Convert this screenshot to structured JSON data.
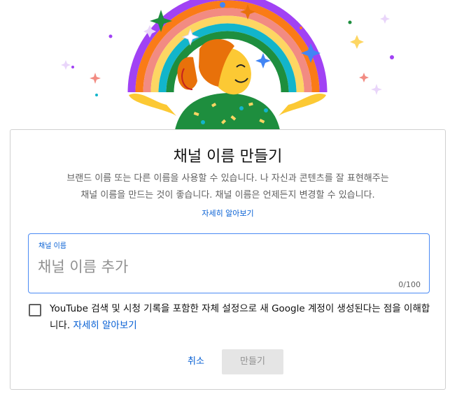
{
  "dialog": {
    "title": "채널 이름 만들기",
    "description_line1": "브랜드 이름 또는 다른 이름을 사용할 수 있습니다. 나 자신과 콘텐츠를 잘 표현해주는",
    "description_line2": "채널 이름을 만드는 것이 좋습니다. 채널 이름은 언제든지 변경할 수 있습니다.",
    "learn_more": "자세히 알아보기"
  },
  "channel_field": {
    "label": "채널 이름",
    "value": "",
    "placeholder": "채널 이름 추가",
    "counter": "0/100"
  },
  "consent": {
    "checked": false,
    "text": "YouTube 검색 및 시청 기록을 포함한 자체 설정으로 새 Google 계정이 생성된다는 점을 이해합니다.",
    "link": "자세히 알아보기"
  },
  "buttons": {
    "cancel": "취소",
    "create": "만들기"
  },
  "colors": {
    "accent": "#065fd4",
    "field_border": "#4a8af4",
    "disabled_bg": "#e5e5e5",
    "rainbow": [
      "#a142f4",
      "#fa7b17",
      "#f28b82",
      "#fdd663",
      "#12b5cb",
      "#1e8e3e"
    ]
  }
}
